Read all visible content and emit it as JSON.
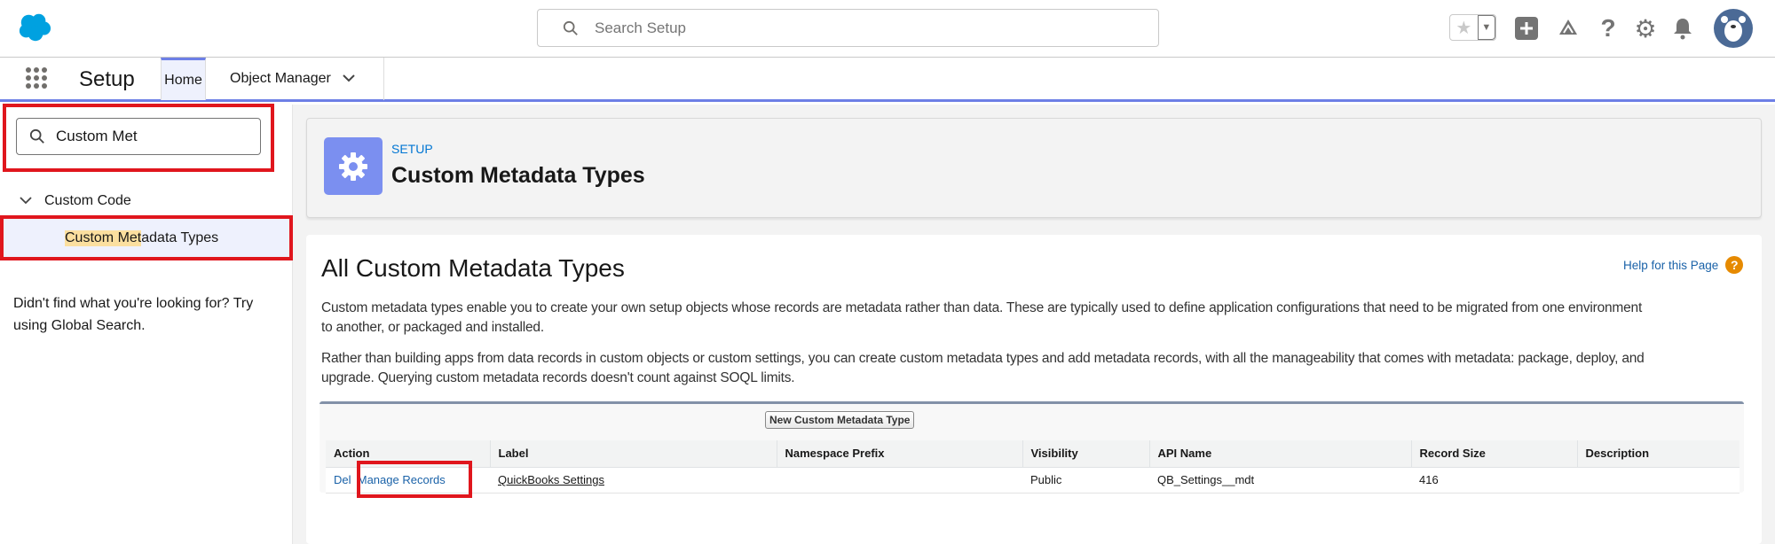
{
  "header": {
    "search_placeholder": "Search Setup"
  },
  "nav": {
    "app_name": "Setup",
    "tabs": [
      {
        "label": "Home"
      },
      {
        "label": "Object Manager"
      }
    ]
  },
  "sidebar": {
    "search_value": "Custom Met",
    "group_label": "Custom Code",
    "item_label_highlight": "Custom Met",
    "item_label_rest": "adata Types",
    "not_found_text": "Didn't find what you're looking for? Try using Global Search."
  },
  "page_header": {
    "eyebrow": "SETUP",
    "title": "Custom Metadata Types"
  },
  "content": {
    "title": "All Custom Metadata Types",
    "help_link": "Help for this Page",
    "help_icon_glyph": "?",
    "para1_lines": [
      "Custom metadata types enable you to create your own setup objects whose records are metadata rather than data. These are typically used to define application configurations that need to be migrated from one environment",
      "to another, or packaged and installed."
    ],
    "para2_lines": [
      "Rather than building apps from data records in custom objects or custom settings, you can create custom metadata types and add metadata records, with all the manageability that comes with metadata: package, deploy, and",
      "upgrade. Querying custom metadata records doesn't count against SOQL limits."
    ],
    "new_button": "New Custom Metadata Type",
    "table": {
      "headers": [
        "Action",
        "Label",
        "Namespace Prefix",
        "Visibility",
        "API Name",
        "Record Size",
        "Description"
      ],
      "rows": [
        {
          "action_del": "Del",
          "action_manage": "Manage Records",
          "label": "QuickBooks Settings",
          "namespace": "",
          "visibility": "Public",
          "api_name": "QB_Settings__mdt",
          "record_size": "416",
          "description": ""
        }
      ]
    }
  },
  "colors": {
    "brand": "#00a1e0",
    "accent": "#6d7fe6",
    "link": "#1a62a8",
    "highlight_box": "#e0161d"
  }
}
